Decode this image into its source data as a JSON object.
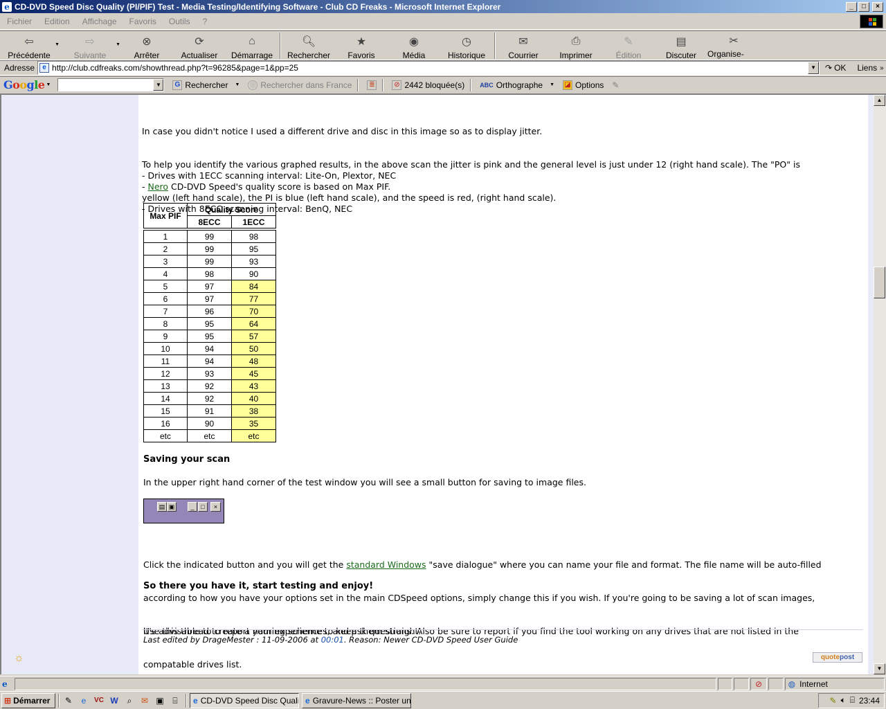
{
  "window": {
    "title": "CD-DVD Speed Disc Quality (PI/PIF) Test - Media Testing/Identifying Software - Club CD Freaks - Microsoft Internet Explorer"
  },
  "menu": [
    "Fichier",
    "Edition",
    "Affichage",
    "Favoris",
    "Outils",
    "?"
  ],
  "toolbar": {
    "back": "Précédente",
    "forward": "Suivante",
    "stop": "Arrêter",
    "refresh": "Actualiser",
    "home": "Démarrage",
    "search": "Rechercher",
    "favorites": "Favoris",
    "media": "Média",
    "history": "Historique",
    "mail": "Courrier",
    "print": "Imprimer",
    "edit": "Édition",
    "discuss": "Discuter",
    "organize": "Organise-not..."
  },
  "address": {
    "label": "Adresse",
    "url": "http://club.cdfreaks.com/showthread.php?t=96285&page=1&pp=25",
    "go": "OK",
    "links": "Liens"
  },
  "google": {
    "search_btn": "Rechercher",
    "search_france": "Rechercher dans France",
    "blocked": "2442 bloquée(s)",
    "spell": "Orthographe",
    "options": "Options"
  },
  "post": {
    "p1_l1": "In case you didn't notice I used a different drive and disc in this image so as to display jitter.",
    "p1_l2": "To help you identify the various graphed results, in the above scan the jitter is pink and the general level is just under 12 (right hand scale). The \"PO\" is",
    "p1_l3": "yellow (left hand scale), the PI is blue (left hand scale), and the speed is red, (right hand scale).",
    "p2_l1": "- Drives with 1ECC scanning interval: Lite-On, Plextor, NEC",
    "p2_l2": "- Drives with 8ECC scanning interval: BenQ, NEC",
    "p3_prefix": "- ",
    "p3_link": "Nero",
    "p3_suffix": " CD-DVD Speed's quality score is based on Max PIF.",
    "saving_head": "Saving your scan",
    "saving_text": "In the upper right hand corner of the test window you will see a small button for saving to image files.",
    "p4_prefix": "Click the indicated button and you will get the ",
    "p4_link": "standard Windows",
    "p4_suffix": " \"save dialogue\" where you can name your file and format. The file name will be auto-filled",
    "p4_l2": "according to how you have your options set in the main CDSpeed options, simply change this if you wish. If you're going to be saving a lot of scan images,",
    "p4_l3": "it's advisable to create a naming scheme to keep them straight.",
    "enjoy": "So there you have it, start testing and enjoy!",
    "p5_l1": "Use this thread to report your experiences, and ask questions. Also be sure to report if you find the tool working on any drives that are not listed in the",
    "p5_l2": "compatable drives list.",
    "edited_prefix": "Last edited by DrageMester : 11-09-2006 at ",
    "edited_time": "00:01",
    "edited_suffix": ". Reason: Newer CD-DVD Speed User Guide",
    "quote_a": "quote",
    "quote_b": "post"
  },
  "table": {
    "h_maxpif": "Max PIF",
    "h_quality": "Quality Score",
    "h_8ecc": "8ECC",
    "h_1ecc": "1ECC",
    "rows": [
      [
        "1",
        "99",
        "98"
      ],
      [
        "2",
        "99",
        "95"
      ],
      [
        "3",
        "99",
        "93"
      ],
      [
        "4",
        "98",
        "90"
      ],
      [
        "5",
        "97",
        "84"
      ],
      [
        "6",
        "97",
        "77"
      ],
      [
        "7",
        "96",
        "70"
      ],
      [
        "8",
        "95",
        "64"
      ],
      [
        "9",
        "95",
        "57"
      ],
      [
        "10",
        "94",
        "50"
      ],
      [
        "11",
        "94",
        "48"
      ],
      [
        "12",
        "93",
        "45"
      ],
      [
        "13",
        "92",
        "43"
      ],
      [
        "14",
        "92",
        "40"
      ],
      [
        "15",
        "91",
        "38"
      ],
      [
        "16",
        "90",
        "35"
      ],
      [
        "etc",
        "etc",
        "etc"
      ]
    ],
    "highlight_from_row": 4,
    "highlight_color": "#ffff99"
  },
  "status": {
    "zone": "Internet"
  },
  "taskbar": {
    "start": "Démarrer",
    "task1": "CD-DVD Speed Disc Quali...",
    "task2": "Gravure-News :: Poster un...",
    "clock": "23:44"
  }
}
